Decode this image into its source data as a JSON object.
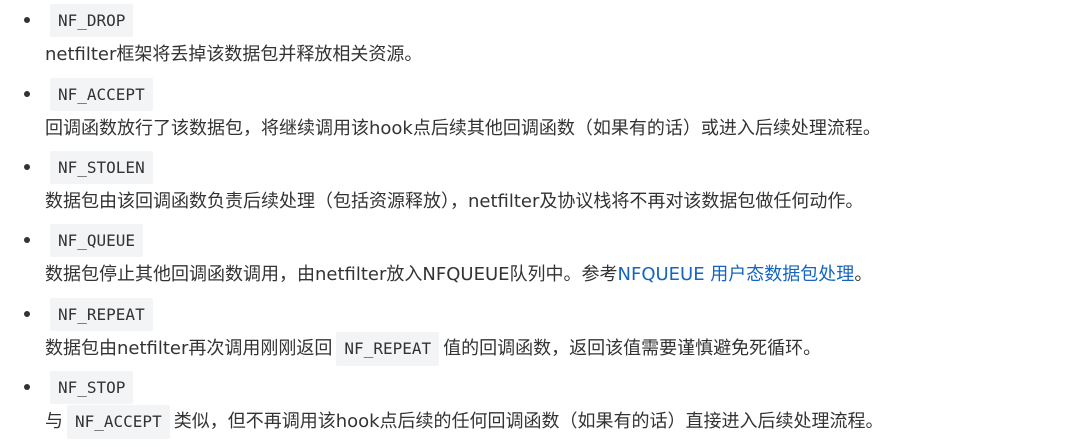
{
  "items": [
    {
      "term": "NF_DROP",
      "desc": "netfilter框架将丢掉该数据包并释放相关资源。"
    },
    {
      "term": "NF_ACCEPT",
      "desc": "回调函数放行了该数据包，将继续调用该hook点后续其他回调函数（如果有的话）或进入后续处理流程。"
    },
    {
      "term": "NF_STOLEN",
      "desc": "数据包由该回调函数负责后续处理（包括资源释放），netfilter及协议栈将不再对该数据包做任何动作。"
    },
    {
      "term": "NF_QUEUE",
      "desc_before": "数据包停止其他回调函数调用，由netfilter放入NFQUEUE队列中。参考",
      "link": "NFQUEUE 用户态数据包处理",
      "desc_after": "。"
    },
    {
      "term": "NF_REPEAT",
      "desc_before": "数据包由netfilter再次调用刚刚返回",
      "code": "NF_REPEAT",
      "desc_after": "值的回调函数，返回该值需要谨慎避免死循环。"
    },
    {
      "term": "NF_STOP",
      "desc_before": "与",
      "code": "NF_ACCEPT",
      "desc_after": "类似，但不再调用该hook点后续的任何回调函数（如果有的话）直接进入后续处理流程。"
    }
  ]
}
